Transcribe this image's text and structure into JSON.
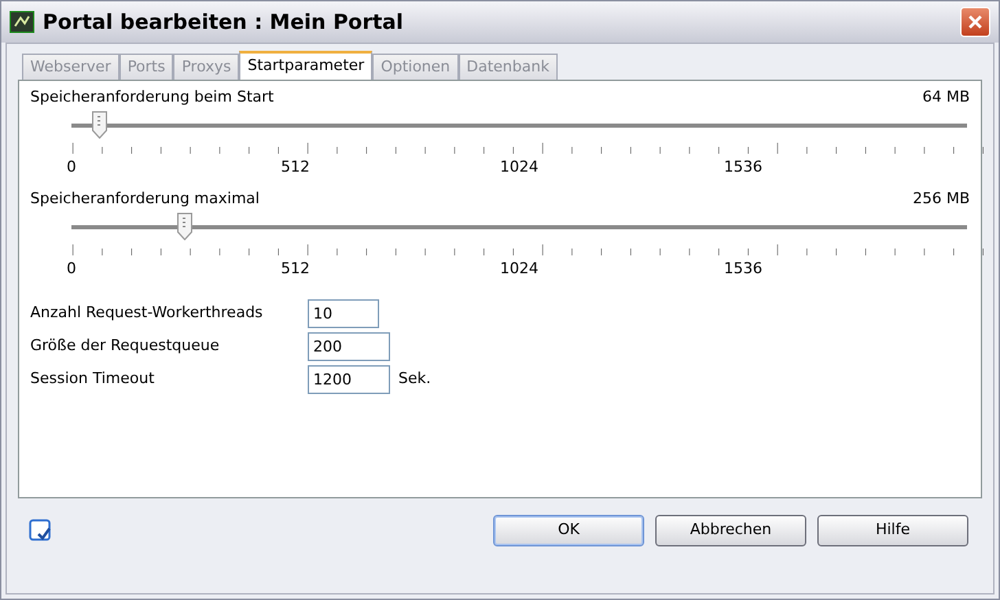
{
  "window": {
    "title": "Portal bearbeiten : Mein Portal"
  },
  "tabs": [
    {
      "label": "Webserver",
      "selected": false
    },
    {
      "label": "Ports",
      "selected": false
    },
    {
      "label": "Proxys",
      "selected": false
    },
    {
      "label": "Startparameter",
      "selected": true
    },
    {
      "label": "Optionen",
      "selected": false
    },
    {
      "label": "Datenbank",
      "selected": false
    }
  ],
  "sliders": [
    {
      "label": "Speicheranforderung beim Start",
      "reading": "64 MB",
      "level": 0.03125,
      "scale": [
        "0",
        "512",
        "1024",
        "1536"
      ]
    },
    {
      "label": "Speicheranforderung maximal",
      "reading": "256 MB",
      "level": 0.125,
      "scale": [
        "0",
        "512",
        "1024",
        "1536"
      ]
    }
  ],
  "fields": [
    {
      "label": "Anzahl Request-Workerthreads",
      "value": "10"
    },
    {
      "label": "Größe der Requestqueue",
      "value": "200"
    },
    {
      "label": "Session Timeout",
      "value": "1200",
      "unit": "Sek."
    }
  ],
  "buttons": [
    {
      "label": "OK",
      "default": true
    },
    {
      "label": "Abbrechen",
      "default": false
    },
    {
      "label": "Hilfe",
      "default": false
    }
  ]
}
